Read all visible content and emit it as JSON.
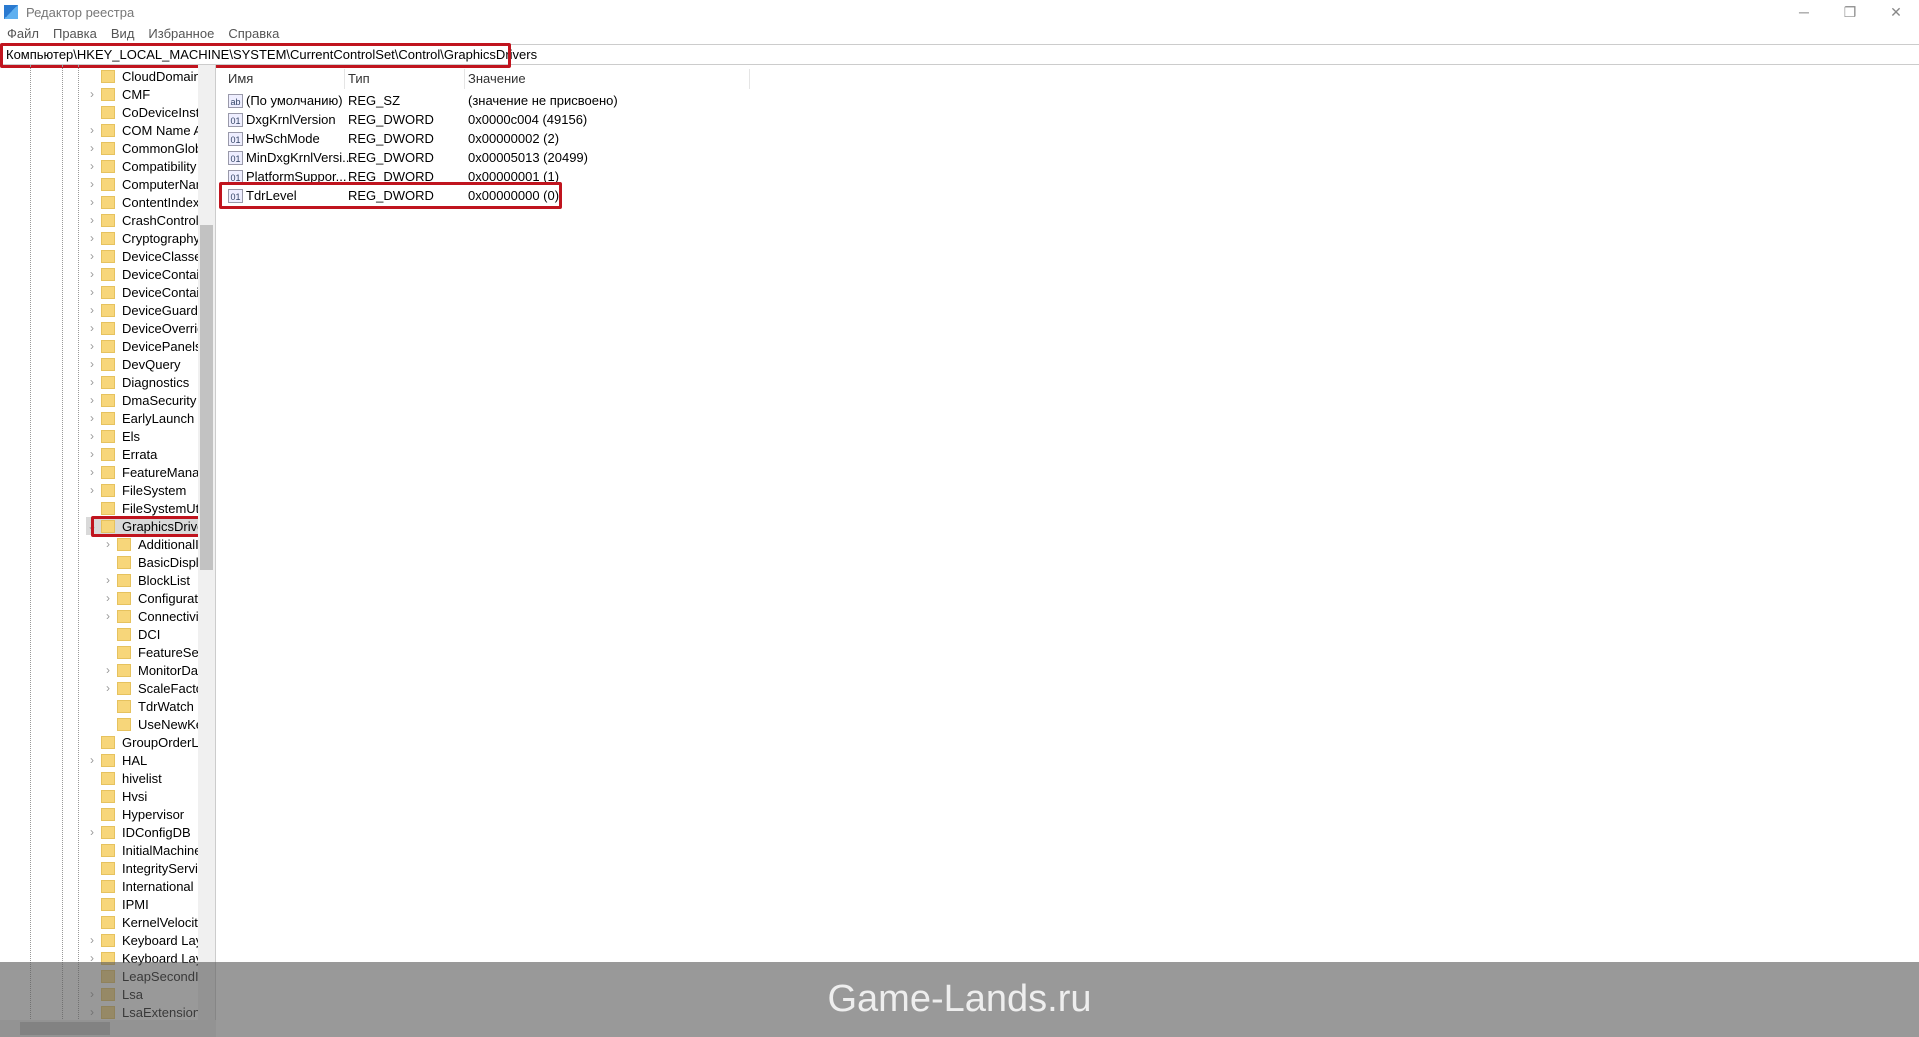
{
  "window": {
    "title": "Редактор реестра",
    "controls": [
      "─",
      "❐",
      "✕"
    ]
  },
  "menu": [
    "Файл",
    "Правка",
    "Вид",
    "Избранное",
    "Справка"
  ],
  "address": "Компьютер\\HKEY_LOCAL_MACHINE\\SYSTEM\\CurrentControlSet\\Control\\GraphicsDrivers",
  "tree": [
    {
      "label": "CloudDomain.",
      "level": 0,
      "exp": "none"
    },
    {
      "label": "CMF",
      "level": 0,
      "exp": "collapsed"
    },
    {
      "label": "CoDeviceInsta",
      "level": 0,
      "exp": "none"
    },
    {
      "label": "COM Name A",
      "level": 0,
      "exp": "collapsed"
    },
    {
      "label": "CommonGlob",
      "level": 0,
      "exp": "collapsed"
    },
    {
      "label": "Compatibility",
      "level": 0,
      "exp": "collapsed"
    },
    {
      "label": "ComputerNan",
      "level": 0,
      "exp": "collapsed"
    },
    {
      "label": "ContentIndex",
      "level": 0,
      "exp": "collapsed"
    },
    {
      "label": "CrashControl",
      "level": 0,
      "exp": "collapsed"
    },
    {
      "label": "Cryptography",
      "level": 0,
      "exp": "collapsed"
    },
    {
      "label": "DeviceClasses",
      "level": 0,
      "exp": "collapsed"
    },
    {
      "label": "DeviceContair",
      "level": 0,
      "exp": "collapsed"
    },
    {
      "label": "DeviceContair",
      "level": 0,
      "exp": "collapsed"
    },
    {
      "label": "DeviceGuard",
      "level": 0,
      "exp": "collapsed"
    },
    {
      "label": "DeviceOverrid",
      "level": 0,
      "exp": "collapsed"
    },
    {
      "label": "DevicePanels",
      "level": 0,
      "exp": "collapsed"
    },
    {
      "label": "DevQuery",
      "level": 0,
      "exp": "collapsed"
    },
    {
      "label": "Diagnostics",
      "level": 0,
      "exp": "collapsed"
    },
    {
      "label": "DmaSecurity",
      "level": 0,
      "exp": "collapsed"
    },
    {
      "label": "EarlyLaunch",
      "level": 0,
      "exp": "collapsed"
    },
    {
      "label": "Els",
      "level": 0,
      "exp": "collapsed"
    },
    {
      "label": "Errata",
      "level": 0,
      "exp": "collapsed"
    },
    {
      "label": "FeatureManag",
      "level": 0,
      "exp": "collapsed"
    },
    {
      "label": "FileSystem",
      "level": 0,
      "exp": "collapsed"
    },
    {
      "label": "FileSystemUtil",
      "level": 0,
      "exp": "none"
    },
    {
      "label": "GraphicsDriver",
      "level": 0,
      "exp": "expanded",
      "selected": true
    },
    {
      "label": "AdditionalI",
      "level": 1,
      "exp": "collapsed"
    },
    {
      "label": "BasicDispla",
      "level": 1,
      "exp": "none"
    },
    {
      "label": "BlockList",
      "level": 1,
      "exp": "collapsed"
    },
    {
      "label": "Configurati",
      "level": 1,
      "exp": "collapsed"
    },
    {
      "label": "Connectivit",
      "level": 1,
      "exp": "collapsed"
    },
    {
      "label": "DCI",
      "level": 1,
      "exp": "none"
    },
    {
      "label": "FeatureSetU",
      "level": 1,
      "exp": "none"
    },
    {
      "label": "MonitorDat",
      "level": 1,
      "exp": "collapsed"
    },
    {
      "label": "ScaleFactor",
      "level": 1,
      "exp": "collapsed"
    },
    {
      "label": "TdrWatch",
      "level": 1,
      "exp": "none"
    },
    {
      "label": "UseNewKey",
      "level": 1,
      "exp": "none"
    },
    {
      "label": "GroupOrderLis",
      "level": 0,
      "exp": "none"
    },
    {
      "label": "HAL",
      "level": 0,
      "exp": "collapsed"
    },
    {
      "label": "hivelist",
      "level": 0,
      "exp": "none"
    },
    {
      "label": "Hvsi",
      "level": 0,
      "exp": "none"
    },
    {
      "label": "Hypervisor",
      "level": 0,
      "exp": "none"
    },
    {
      "label": "IDConfigDB",
      "level": 0,
      "exp": "collapsed"
    },
    {
      "label": "InitialMachine",
      "level": 0,
      "exp": "none"
    },
    {
      "label": "IntegrityServic",
      "level": 0,
      "exp": "none"
    },
    {
      "label": "International",
      "level": 0,
      "exp": "none"
    },
    {
      "label": "IPMI",
      "level": 0,
      "exp": "none"
    },
    {
      "label": "KernelVelocity",
      "level": 0,
      "exp": "none"
    },
    {
      "label": "Keyboard Layc",
      "level": 0,
      "exp": "collapsed"
    },
    {
      "label": "Keyboard Layc",
      "level": 0,
      "exp": "collapsed"
    },
    {
      "label": "LeapSecondIn",
      "level": 0,
      "exp": "none"
    },
    {
      "label": "Lsa",
      "level": 0,
      "exp": "collapsed"
    },
    {
      "label": "LsaExtensionC",
      "level": 0,
      "exp": "collapsed"
    }
  ],
  "columns": [
    "Имя",
    "Тип",
    "Значение"
  ],
  "values": [
    {
      "icon": "string-value-icon",
      "glyph": "ab",
      "name": "(По умолчанию)",
      "type": "REG_SZ",
      "data": "(значение не присвоено)"
    },
    {
      "icon": "dword-value-icon",
      "glyph": "01",
      "name": "DxgKrnlVersion",
      "type": "REG_DWORD",
      "data": "0x0000c004 (49156)"
    },
    {
      "icon": "dword-value-icon",
      "glyph": "01",
      "name": "HwSchMode",
      "type": "REG_DWORD",
      "data": "0x00000002 (2)"
    },
    {
      "icon": "dword-value-icon",
      "glyph": "01",
      "name": "MinDxgKrnlVersi...",
      "type": "REG_DWORD",
      "data": "0x00005013 (20499)"
    },
    {
      "icon": "dword-value-icon",
      "glyph": "01",
      "name": "PlatformSuppor...",
      "type": "REG_DWORD",
      "data": "0x00000001 (1)"
    },
    {
      "icon": "dword-value-icon",
      "glyph": "01",
      "name": "TdrLevel",
      "type": "REG_DWORD",
      "data": "0x00000000 (0)",
      "highlighted": true
    }
  ],
  "watermark": "Game-Lands.ru",
  "colors": {
    "highlight": "#c0141e",
    "folder": "#f7d67a"
  }
}
